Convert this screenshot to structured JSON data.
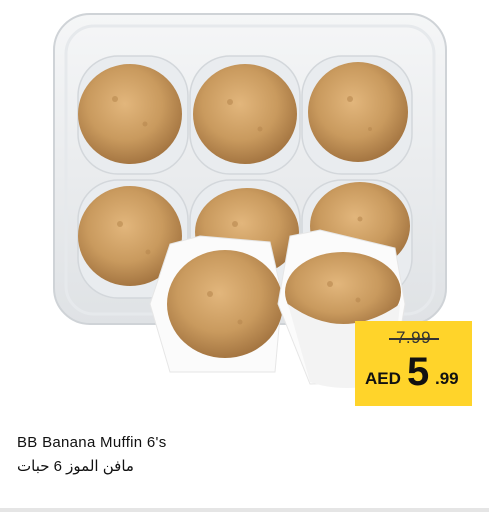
{
  "product": {
    "name_en": "BB Banana Muffin 6's",
    "name_ar": "مافن الموز 6 حبات"
  },
  "price": {
    "old": "7.99",
    "currency": "AED",
    "main": "5",
    "decimals": ".99"
  },
  "colors": {
    "price_tag": "#ffd42a",
    "muffin": "#c99a5e",
    "tray": "#eef0f2"
  },
  "icons": {
    "product_image": "muffins-tray-image"
  }
}
